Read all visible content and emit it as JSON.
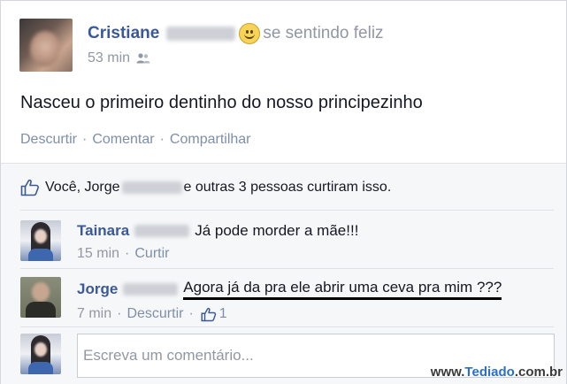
{
  "post": {
    "author": "Cristiane",
    "feeling": "se sentindo feliz",
    "time": "53 min",
    "text": "Nasceu o primeiro dentinho do nosso principezinho",
    "actions": {
      "unlike": "Descurtir",
      "separator": "·",
      "comment": "Comentar",
      "share": "Compartilhar"
    }
  },
  "likes": {
    "prefix": "Você, Jorge",
    "suffix": "e outras 3 pessoas curtiram isso."
  },
  "comments": [
    {
      "author": "Tainara",
      "text": "Já pode morder a mãe!!!",
      "time": "15 min",
      "action": "Curtir",
      "like_count": ""
    },
    {
      "author": "Jorge",
      "text": "Agora já da pra ele abrir uma ceva pra mim ???",
      "time": "7 min",
      "action": "Descurtir",
      "like_count": "1"
    }
  ],
  "composer": {
    "placeholder": "Escreva um comentário..."
  },
  "watermark": {
    "part1": "www.",
    "part2": "Tediado",
    "part3": ".com.br"
  },
  "colors": {
    "link": "#3b5998",
    "muted": "#9197a3",
    "ufi_bg": "#f6f7f9"
  }
}
